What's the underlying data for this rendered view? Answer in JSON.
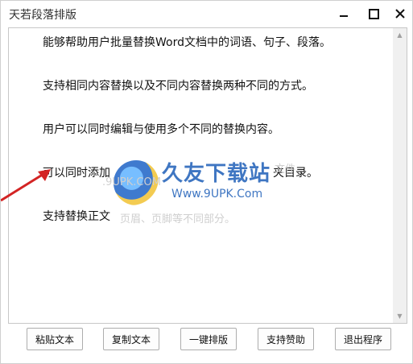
{
  "window": {
    "title": "天若段落排版"
  },
  "content": {
    "lines": [
      "能够帮助用户批量替换Word文档中的词语、句子、段落。",
      "支持相同内容替换以及不同内容替换两种不同的方式。",
      "用户可以同时编辑与使用多个不同的替换内容。",
      "可以同时添加",
      "夹目录。",
      "支持替换正文"
    ],
    "faint_overlay": [
      "文件",
      "页眉、页脚等不同部分。"
    ]
  },
  "watermark": {
    "title": "久友下载站",
    "url": "Www.9UPK.Com",
    "small": ".9UPK.COM"
  },
  "buttons": {
    "paste": "粘贴文本",
    "copy": "复制文本",
    "format": "一键排版",
    "donate": "支持赞助",
    "exit": "退出程序"
  },
  "colors": {
    "arrow": "#d32424",
    "watermark": "#1e5fb8"
  }
}
